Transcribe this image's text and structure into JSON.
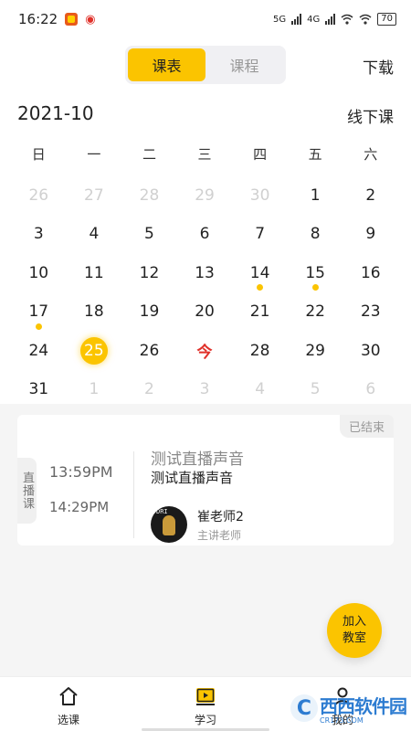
{
  "status_bar": {
    "time": "16:22",
    "network_1": "5G",
    "network_2": "4G",
    "battery": "70"
  },
  "header": {
    "tabs": [
      {
        "label": "课表",
        "active": true
      },
      {
        "label": "课程",
        "active": false
      }
    ],
    "download_label": "下载"
  },
  "calendar": {
    "month": "2021-10",
    "mode_label": "线下课",
    "weekdays": [
      "日",
      "一",
      "二",
      "三",
      "四",
      "五",
      "六"
    ],
    "weeks": [
      [
        {
          "d": "26",
          "muted": true
        },
        {
          "d": "27",
          "muted": true
        },
        {
          "d": "28",
          "muted": true
        },
        {
          "d": "29",
          "muted": true
        },
        {
          "d": "30",
          "muted": true
        },
        {
          "d": "1"
        },
        {
          "d": "2"
        }
      ],
      [
        {
          "d": "3"
        },
        {
          "d": "4"
        },
        {
          "d": "5"
        },
        {
          "d": "6"
        },
        {
          "d": "7"
        },
        {
          "d": "8"
        },
        {
          "d": "9"
        }
      ],
      [
        {
          "d": "10"
        },
        {
          "d": "11"
        },
        {
          "d": "12"
        },
        {
          "d": "13"
        },
        {
          "d": "14",
          "dot": true
        },
        {
          "d": "15",
          "dot": true
        },
        {
          "d": "16"
        }
      ],
      [
        {
          "d": "17",
          "dot": true
        },
        {
          "d": "18"
        },
        {
          "d": "19"
        },
        {
          "d": "20"
        },
        {
          "d": "21"
        },
        {
          "d": "22"
        },
        {
          "d": "23"
        }
      ],
      [
        {
          "d": "24"
        },
        {
          "d": "25",
          "selected": true
        },
        {
          "d": "26"
        },
        {
          "d": "今",
          "today": true
        },
        {
          "d": "28"
        },
        {
          "d": "29"
        },
        {
          "d": "30"
        }
      ],
      [
        {
          "d": "31"
        },
        {
          "d": "1",
          "muted": true
        },
        {
          "d": "2",
          "muted": true
        },
        {
          "d": "3",
          "muted": true
        },
        {
          "d": "4",
          "muted": true
        },
        {
          "d": "5",
          "muted": true
        },
        {
          "d": "6",
          "muted": true
        }
      ]
    ]
  },
  "lesson_card": {
    "status": "已结束",
    "type": "直播课",
    "start_time": "13:59PM",
    "end_time": "14:29PM",
    "title": "测试直播声音",
    "subtitle": "测试直播声音",
    "teacher_name": "崔老师2",
    "teacher_role": "主讲老师"
  },
  "fab": {
    "line1": "加入",
    "line2": "教室"
  },
  "tabbar": {
    "items": [
      {
        "label": "选课",
        "icon": "home-icon"
      },
      {
        "label": "学习",
        "icon": "play-icon"
      },
      {
        "label": "我的",
        "icon": "user-icon"
      }
    ]
  },
  "watermark": {
    "main": "西西软件园",
    "sub": "CR173.COM"
  },
  "colors": {
    "accent": "#fbc400",
    "today": "#e0312a",
    "muted": "#d0d0d0"
  }
}
